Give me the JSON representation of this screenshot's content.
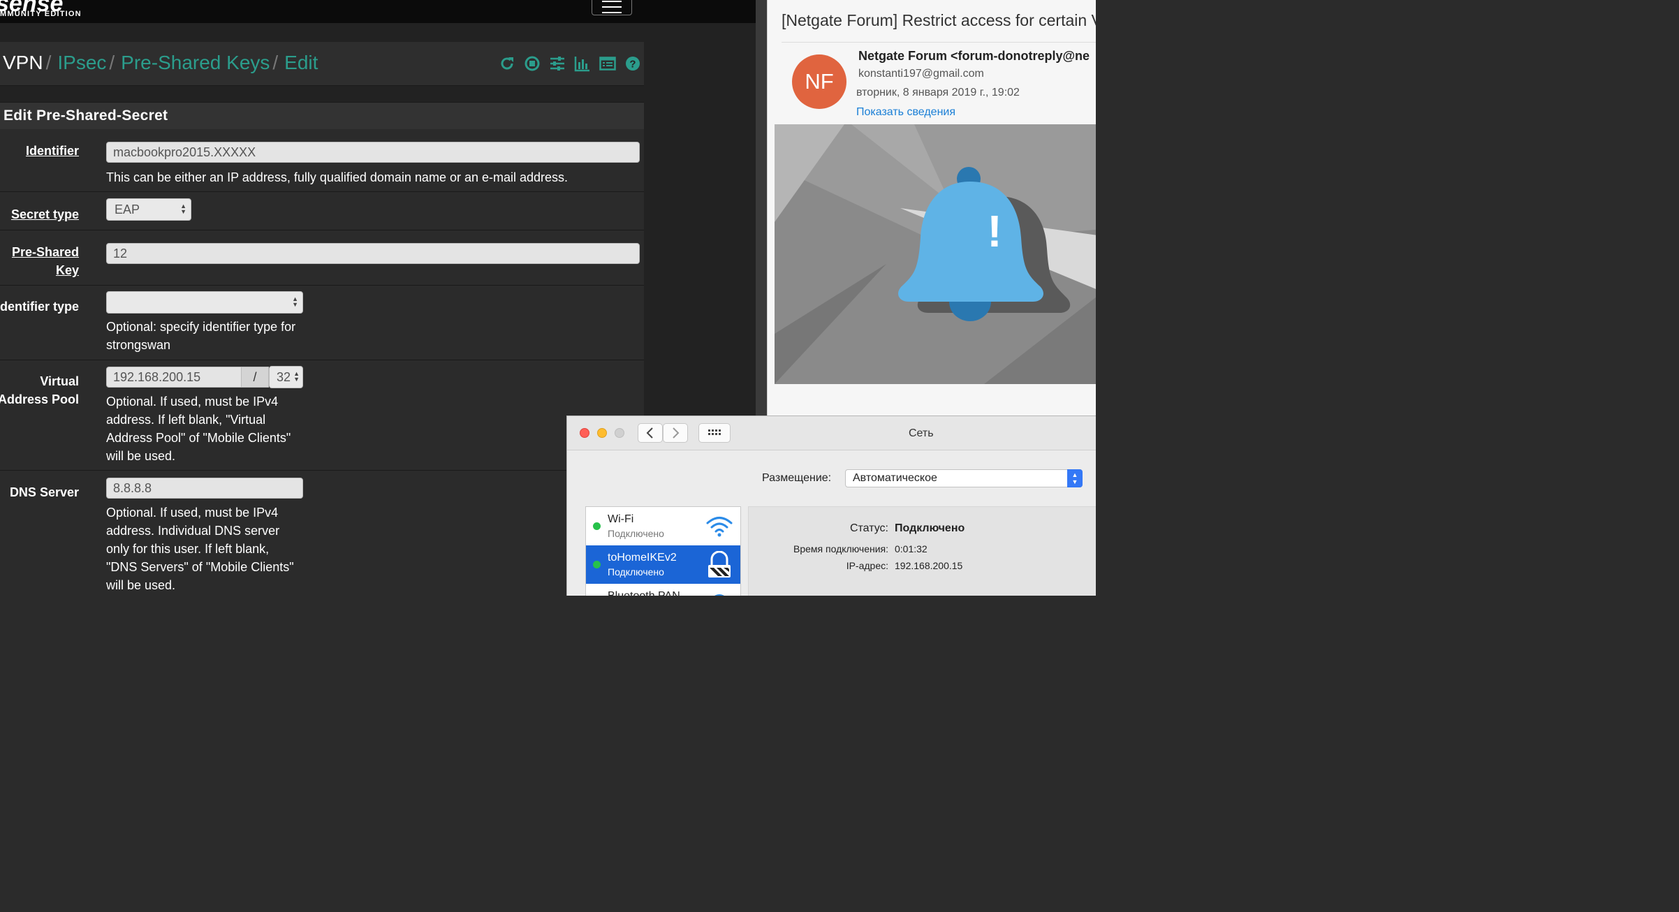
{
  "pfsense": {
    "logo": "sense",
    "edition": "MMUNITY EDITION",
    "breadcrumb": {
      "root": "VPN",
      "items": [
        "IPsec",
        "Pre-Shared Keys",
        "Edit"
      ],
      "separator": "/"
    },
    "toolbar_icons": [
      "restart-icon",
      "stop-icon",
      "settings-sliders-icon",
      "chart-icon",
      "log-list-icon",
      "help-icon"
    ],
    "panel_title": "Edit Pre-Shared-Secret",
    "fields": {
      "identifier": {
        "label": "Identifier",
        "value": "macbookpro2015.XXXXX",
        "help": "This can be either an IP address, fully qualified domain name or an e-mail address."
      },
      "secret_type": {
        "label": "Secret type",
        "value": "EAP"
      },
      "psk": {
        "label_line1": "Pre-Shared",
        "label_line2": "Key",
        "value": "12"
      },
      "identifier_type": {
        "label": "Identifier type",
        "value": "",
        "help_line1": "Optional: specify identifier type for",
        "help_line2": "strongswan"
      },
      "pool": {
        "label_line1": "Virtual",
        "label_line2": "Address Pool",
        "address": "192.168.200.15",
        "separator": "/",
        "mask": "32",
        "help": [
          "Optional. If used, must be IPv4",
          "address. If left blank, \"Virtual",
          "Address Pool\" of \"Mobile Clients\"",
          "will be used."
        ]
      },
      "dns": {
        "label": "DNS Server",
        "value": "8.8.8.8",
        "help": [
          "Optional. If used, must be IPv4",
          "address. Individual DNS server",
          "only for this user. If left blank,",
          "\"DNS Servers\" of \"Mobile Clients\"",
          "will be used."
        ]
      }
    },
    "colors": {
      "accent": "#2b9d8c",
      "background": "#222222"
    }
  },
  "mail": {
    "subject": "[Netgate Forum] Restrict access for certain V",
    "avatar_initials": "NF",
    "from": "Netgate Forum <forum-donotreply@ne",
    "to": "konstanti197@gmail.com",
    "date": "вторник, 8 января 2019 г., 19:02",
    "details_link": "Показать сведения",
    "image_icon": "notification-bell-icon",
    "bell_mark": "!"
  },
  "network": {
    "title": "Сеть",
    "location_label": "Размещение:",
    "location_value": "Автоматическое",
    "services": [
      {
        "name": "Wi-Fi",
        "status": "Подключено",
        "icon": "wifi-icon"
      },
      {
        "name": "toHomeIKEv2",
        "status": "Подключено",
        "icon": "vpn-lock-icon"
      },
      {
        "name": "Bluetooth PAN",
        "status": "",
        "icon": "bluetooth-icon"
      }
    ],
    "details": {
      "status_label": "Статус:",
      "status_value": "Подключено",
      "time_label": "Время подключения:",
      "time_value": "0:01:32",
      "ip_label": "IP-адрес:",
      "ip_value": "192.168.200.15"
    }
  }
}
